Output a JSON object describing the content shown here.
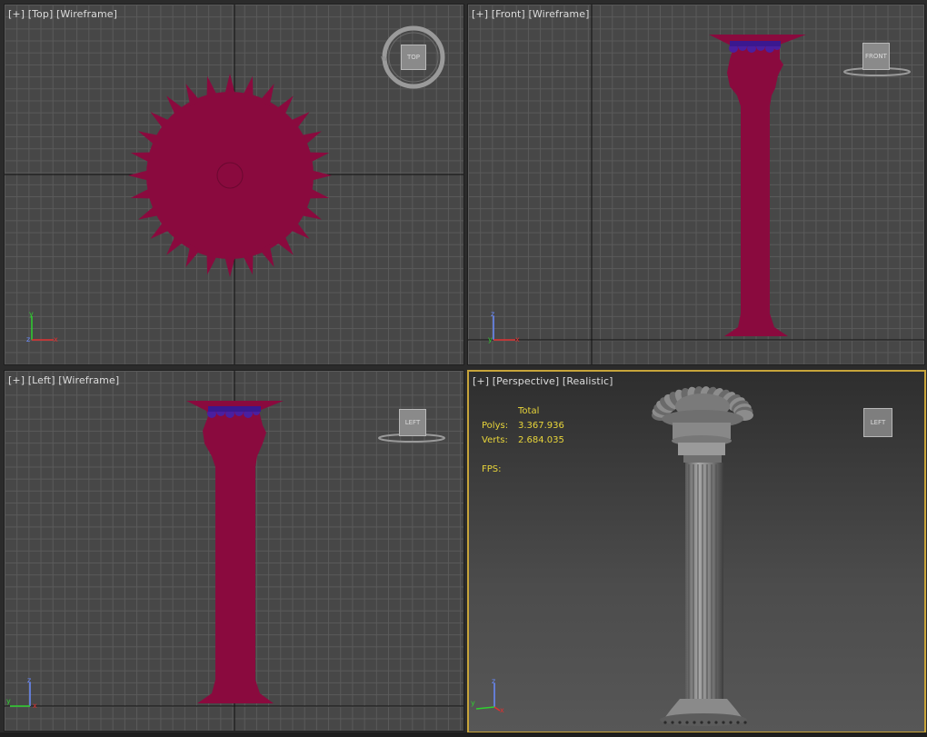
{
  "viewports": {
    "top": {
      "label_plus": "[+]",
      "label_view": "[Top]",
      "label_mode": "[Wireframe]",
      "viewcube": "TOP"
    },
    "front": {
      "label_plus": "[+]",
      "label_view": "[Front]",
      "label_mode": "[Wireframe]",
      "viewcube": "FRONT"
    },
    "left": {
      "label_plus": "[+]",
      "label_view": "[Left]",
      "label_mode": "[Wireframe]",
      "viewcube": "LEFT"
    },
    "perspective": {
      "label_plus": "[+]",
      "label_view": "[Perspective]",
      "label_mode": "[Realistic]",
      "viewcube": "LEFT",
      "stats": {
        "header": "Total",
        "polys_label": "Polys:",
        "polys_value": "3.367.936",
        "verts_label": "Verts:",
        "verts_value": "2.684.035",
        "fps_label": "FPS:"
      }
    }
  },
  "axes": {
    "x": "x",
    "y": "y",
    "z": "z"
  },
  "colors": {
    "object": "#8a0a3e",
    "capital": "#4a1fa0",
    "active_border": "#c7a43a",
    "stats_text": "#e8d53a"
  }
}
